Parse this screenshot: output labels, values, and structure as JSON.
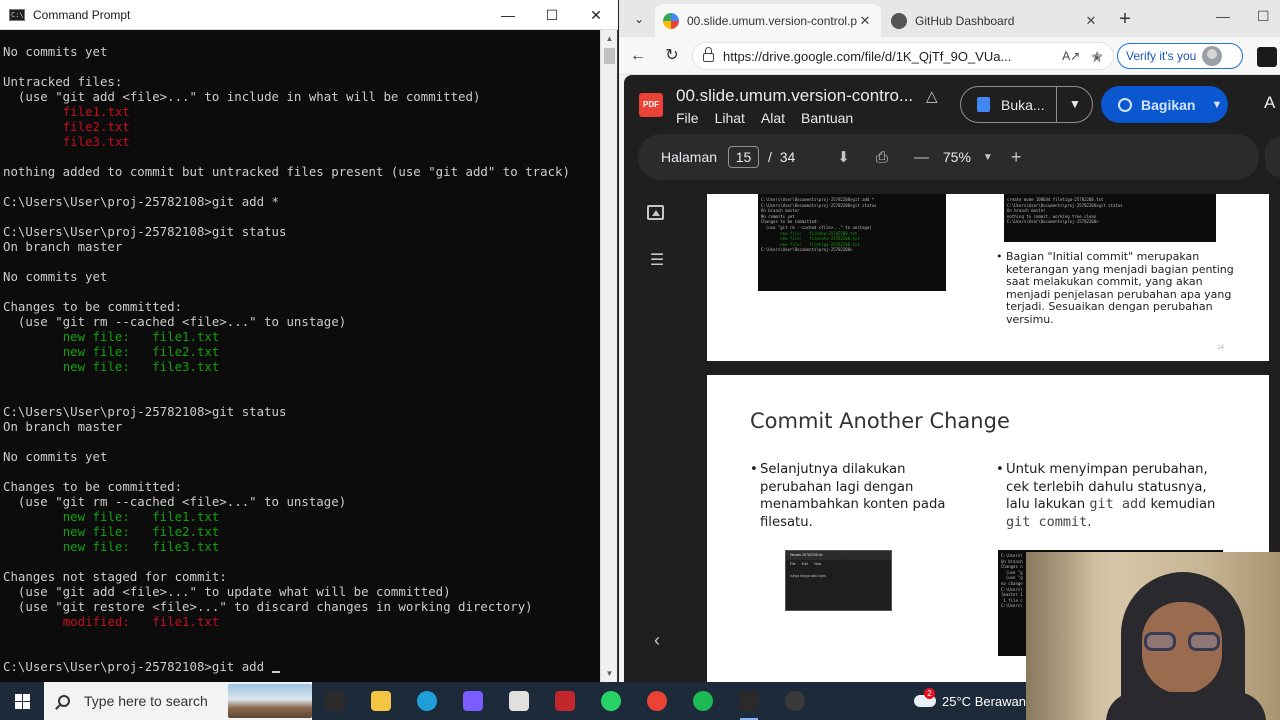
{
  "cmd": {
    "title": "Command Prompt",
    "lines": [
      [
        {
          "t": "No commits yet"
        }
      ],
      [],
      [
        {
          "t": "Untracked files:"
        }
      ],
      [
        {
          "t": "  (use \"git add <file>...\" to include in what will be committed)"
        }
      ],
      [
        {
          "t": "        "
        },
        {
          "t": "file1.txt",
          "c": "red"
        }
      ],
      [
        {
          "t": "        "
        },
        {
          "t": "file2.txt",
          "c": "red"
        }
      ],
      [
        {
          "t": "        "
        },
        {
          "t": "file3.txt",
          "c": "red"
        }
      ],
      [],
      [
        {
          "t": "nothing added to commit but untracked files present (use \"git add\" to track)"
        }
      ],
      [],
      [
        {
          "t": "C:\\Users\\User\\proj-25782108>git add *"
        }
      ],
      [],
      [
        {
          "t": "C:\\Users\\User\\proj-25782108>git status"
        }
      ],
      [
        {
          "t": "On branch master"
        }
      ],
      [],
      [
        {
          "t": "No commits yet"
        }
      ],
      [],
      [
        {
          "t": "Changes to be committed:"
        }
      ],
      [
        {
          "t": "  (use \"git rm --cached <file>...\" to unstage)"
        }
      ],
      [
        {
          "t": "        "
        },
        {
          "t": "new file:   file1.txt",
          "c": "green"
        }
      ],
      [
        {
          "t": "        "
        },
        {
          "t": "new file:   file2.txt",
          "c": "green"
        }
      ],
      [
        {
          "t": "        "
        },
        {
          "t": "new file:   file3.txt",
          "c": "green"
        }
      ],
      [],
      [],
      [
        {
          "t": "C:\\Users\\User\\proj-25782108>git status"
        }
      ],
      [
        {
          "t": "On branch master"
        }
      ],
      [],
      [
        {
          "t": "No commits yet"
        }
      ],
      [],
      [
        {
          "t": "Changes to be committed:"
        }
      ],
      [
        {
          "t": "  (use \"git rm --cached <file>...\" to unstage)"
        }
      ],
      [
        {
          "t": "        "
        },
        {
          "t": "new file:   file1.txt",
          "c": "green"
        }
      ],
      [
        {
          "t": "        "
        },
        {
          "t": "new file:   file2.txt",
          "c": "green"
        }
      ],
      [
        {
          "t": "        "
        },
        {
          "t": "new file:   file3.txt",
          "c": "green"
        }
      ],
      [],
      [
        {
          "t": "Changes not staged for commit:"
        }
      ],
      [
        {
          "t": "  (use \"git add <file>...\" to update what will be committed)"
        }
      ],
      [
        {
          "t": "  (use \"git restore <file>...\" to discard changes in working directory)"
        }
      ],
      [
        {
          "t": "        "
        },
        {
          "t": "modified:   file1.txt",
          "c": "red"
        }
      ],
      [],
      [],
      [
        {
          "t": "C:\\Users\\User\\proj-25782108>git add "
        }
      ]
    ]
  },
  "browser": {
    "tabs": [
      {
        "label": "00.slide.umum.version-control.pdf",
        "active": true
      },
      {
        "label": "GitHub Dashboard",
        "active": false
      }
    ],
    "url": "https://drive.google.com/file/d/1K_QjTf_9O_VUa...",
    "verify_label": "Verify it's you"
  },
  "drive": {
    "file_title": "00.slide.umum.version-contro...",
    "menu": [
      "File",
      "Lihat",
      "Alat",
      "Bantuan"
    ],
    "open_label": "Buka...",
    "share_label": "Bagikan",
    "account_initial": "A",
    "page_label": "Halaman",
    "current_page": "15",
    "page_sep": "/",
    "total_pages": "34",
    "zoom": "75%"
  },
  "slide_prev": {
    "shot_left": [
      "C:\\Users\\User\\Documents\\proj-25782208>git add *",
      "C:\\Users\\User\\Documents\\proj-25782208>git status",
      "On branch master",
      "No commits yet",
      "Changes to be committed:",
      "  (use \"git rm --cached <file>...\" to unstage)",
      "        new file:   fileaha-25782208.txt",
      "        new file:   filesate-25782208.txt",
      "        new file:   filetiga-25782208.txt",
      "C:\\Users\\User\\Documents\\proj-25782208>"
    ],
    "shot_right": [
      "create mode 100644 filetiga-25782208.txt",
      "C:\\Users\\User\\Documents\\proj-25782208>git status",
      "On branch master",
      "nothing to commit, working tree clean",
      "C:\\Users\\User\\Documents\\proj-25782208>"
    ],
    "bullet": "Bagian \"Initial commit\" merupakan keterangan yang menjadi bagian penting saat melakukan commit, yang akan menjadi penjelasan perubahan apa yang terjadi. Sesuaikan dengan perubahan versimu.",
    "page_number": "14"
  },
  "slide_current": {
    "title": "Commit Another Change",
    "bullet_left": "Selanjutnya dilakukan perubahan lagi dengan menambahkan konten pada filesatu.",
    "bullet_right_pre": "Untuk menyimpan perubahan, cek terlebih dahulu statusnya, lalu lakukan ",
    "code1": "git add",
    "bullet_right_mid": " kemudian ",
    "code2": "git commit",
    "bullet_right_end": ".",
    "notepad_title": "filesatu-25782208.txt",
    "notepad_menu": [
      "File",
      "Edit",
      "View"
    ],
    "notepad_text": "Isinya hanya satu baris",
    "shot_right": [
      "C:\\Users\\",
      "On branch",
      "Changes n",
      "  (use \"g",
      "  (use \"g",
      "no change",
      "C:\\Users\\",
      "[master 1",
      " 1 file c",
      "C:\\Users\\"
    ]
  },
  "taskbar": {
    "search_placeholder": "Type here to search",
    "weather_temp": "25°C",
    "weather_text": "Berawan",
    "notification_count": "2",
    "apps": [
      {
        "name": "task-view-icon",
        "color": "#2b2b2b"
      },
      {
        "name": "file-explorer-icon",
        "color": "#f4c542"
      },
      {
        "name": "edge-icon",
        "color": "#1f9ed8"
      },
      {
        "name": "copilot-icon",
        "color": "#7b5cff"
      },
      {
        "name": "cloud-app-icon",
        "color": "#e0e0e0"
      },
      {
        "name": "mendeley-icon",
        "color": "#c2272d"
      },
      {
        "name": "whatsapp-icon",
        "color": "#25d366"
      },
      {
        "name": "chrome-icon",
        "color": "#ea4335"
      },
      {
        "name": "spotify-icon",
        "color": "#1db954"
      },
      {
        "name": "terminal-icon",
        "color": "#2a2a2a"
      },
      {
        "name": "obs-icon",
        "color": "#3a3a3a"
      }
    ]
  }
}
